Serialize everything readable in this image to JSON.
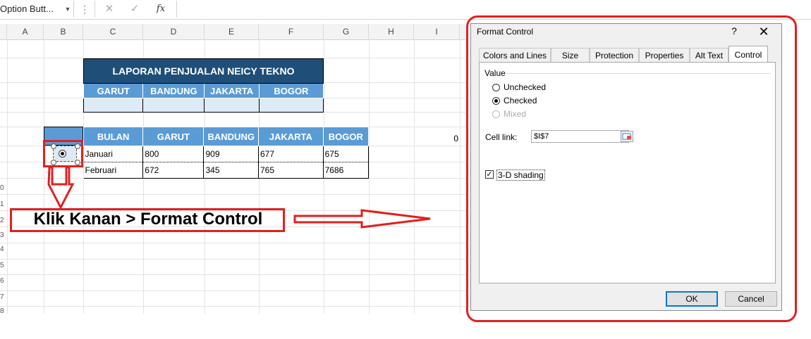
{
  "formula_bar": {
    "name_box": "Option Butt...",
    "name_box_arrow": "▼",
    "dots": "⋮",
    "cancel_glyph": "✕",
    "enter_glyph": "✓",
    "fx_glyph": "fx"
  },
  "spreadsheet": {
    "columns": [
      "A",
      "B",
      "C",
      "D",
      "E",
      "F",
      "G",
      "H",
      "I"
    ],
    "row_numbers": [
      "0",
      "1",
      "2",
      "3",
      "4",
      "5",
      "6",
      "7",
      "8"
    ],
    "i_cell_value": "0"
  },
  "report1": {
    "title": "LAPORAN PENJUALAN NEICY TEKNO",
    "headers": [
      "GARUT",
      "BANDUNG",
      "JAKARTA",
      "BOGOR"
    ]
  },
  "report2": {
    "headers": [
      "BULAN",
      "GARUT",
      "BANDUNG",
      "JAKARTA",
      "BOGOR"
    ],
    "rows": [
      [
        "Januari",
        "800",
        "909",
        "677",
        "675"
      ],
      [
        "Februari",
        "672",
        "345",
        "765",
        "7686"
      ]
    ]
  },
  "annotation": {
    "callout": "Klik Kanan > Format Control",
    "color": "#e02020"
  },
  "dialog": {
    "title": "Format Control",
    "help": "?",
    "close": "✕",
    "tabs": [
      "Colors and Lines",
      "Size",
      "Protection",
      "Properties",
      "Alt Text",
      "Control"
    ],
    "active_tab": "Control",
    "value_group_label": "Value",
    "options": {
      "unchecked": "Unchecked",
      "checked": "Checked",
      "mixed": "Mixed",
      "selected": "Checked"
    },
    "cell_link_label": "Cell link:",
    "cell_link_value": "$I$7",
    "shading_label": "3-D shading",
    "shading_checked": true,
    "check_glyph": "✓",
    "ok_label": "OK",
    "cancel_label": "Cancel"
  }
}
